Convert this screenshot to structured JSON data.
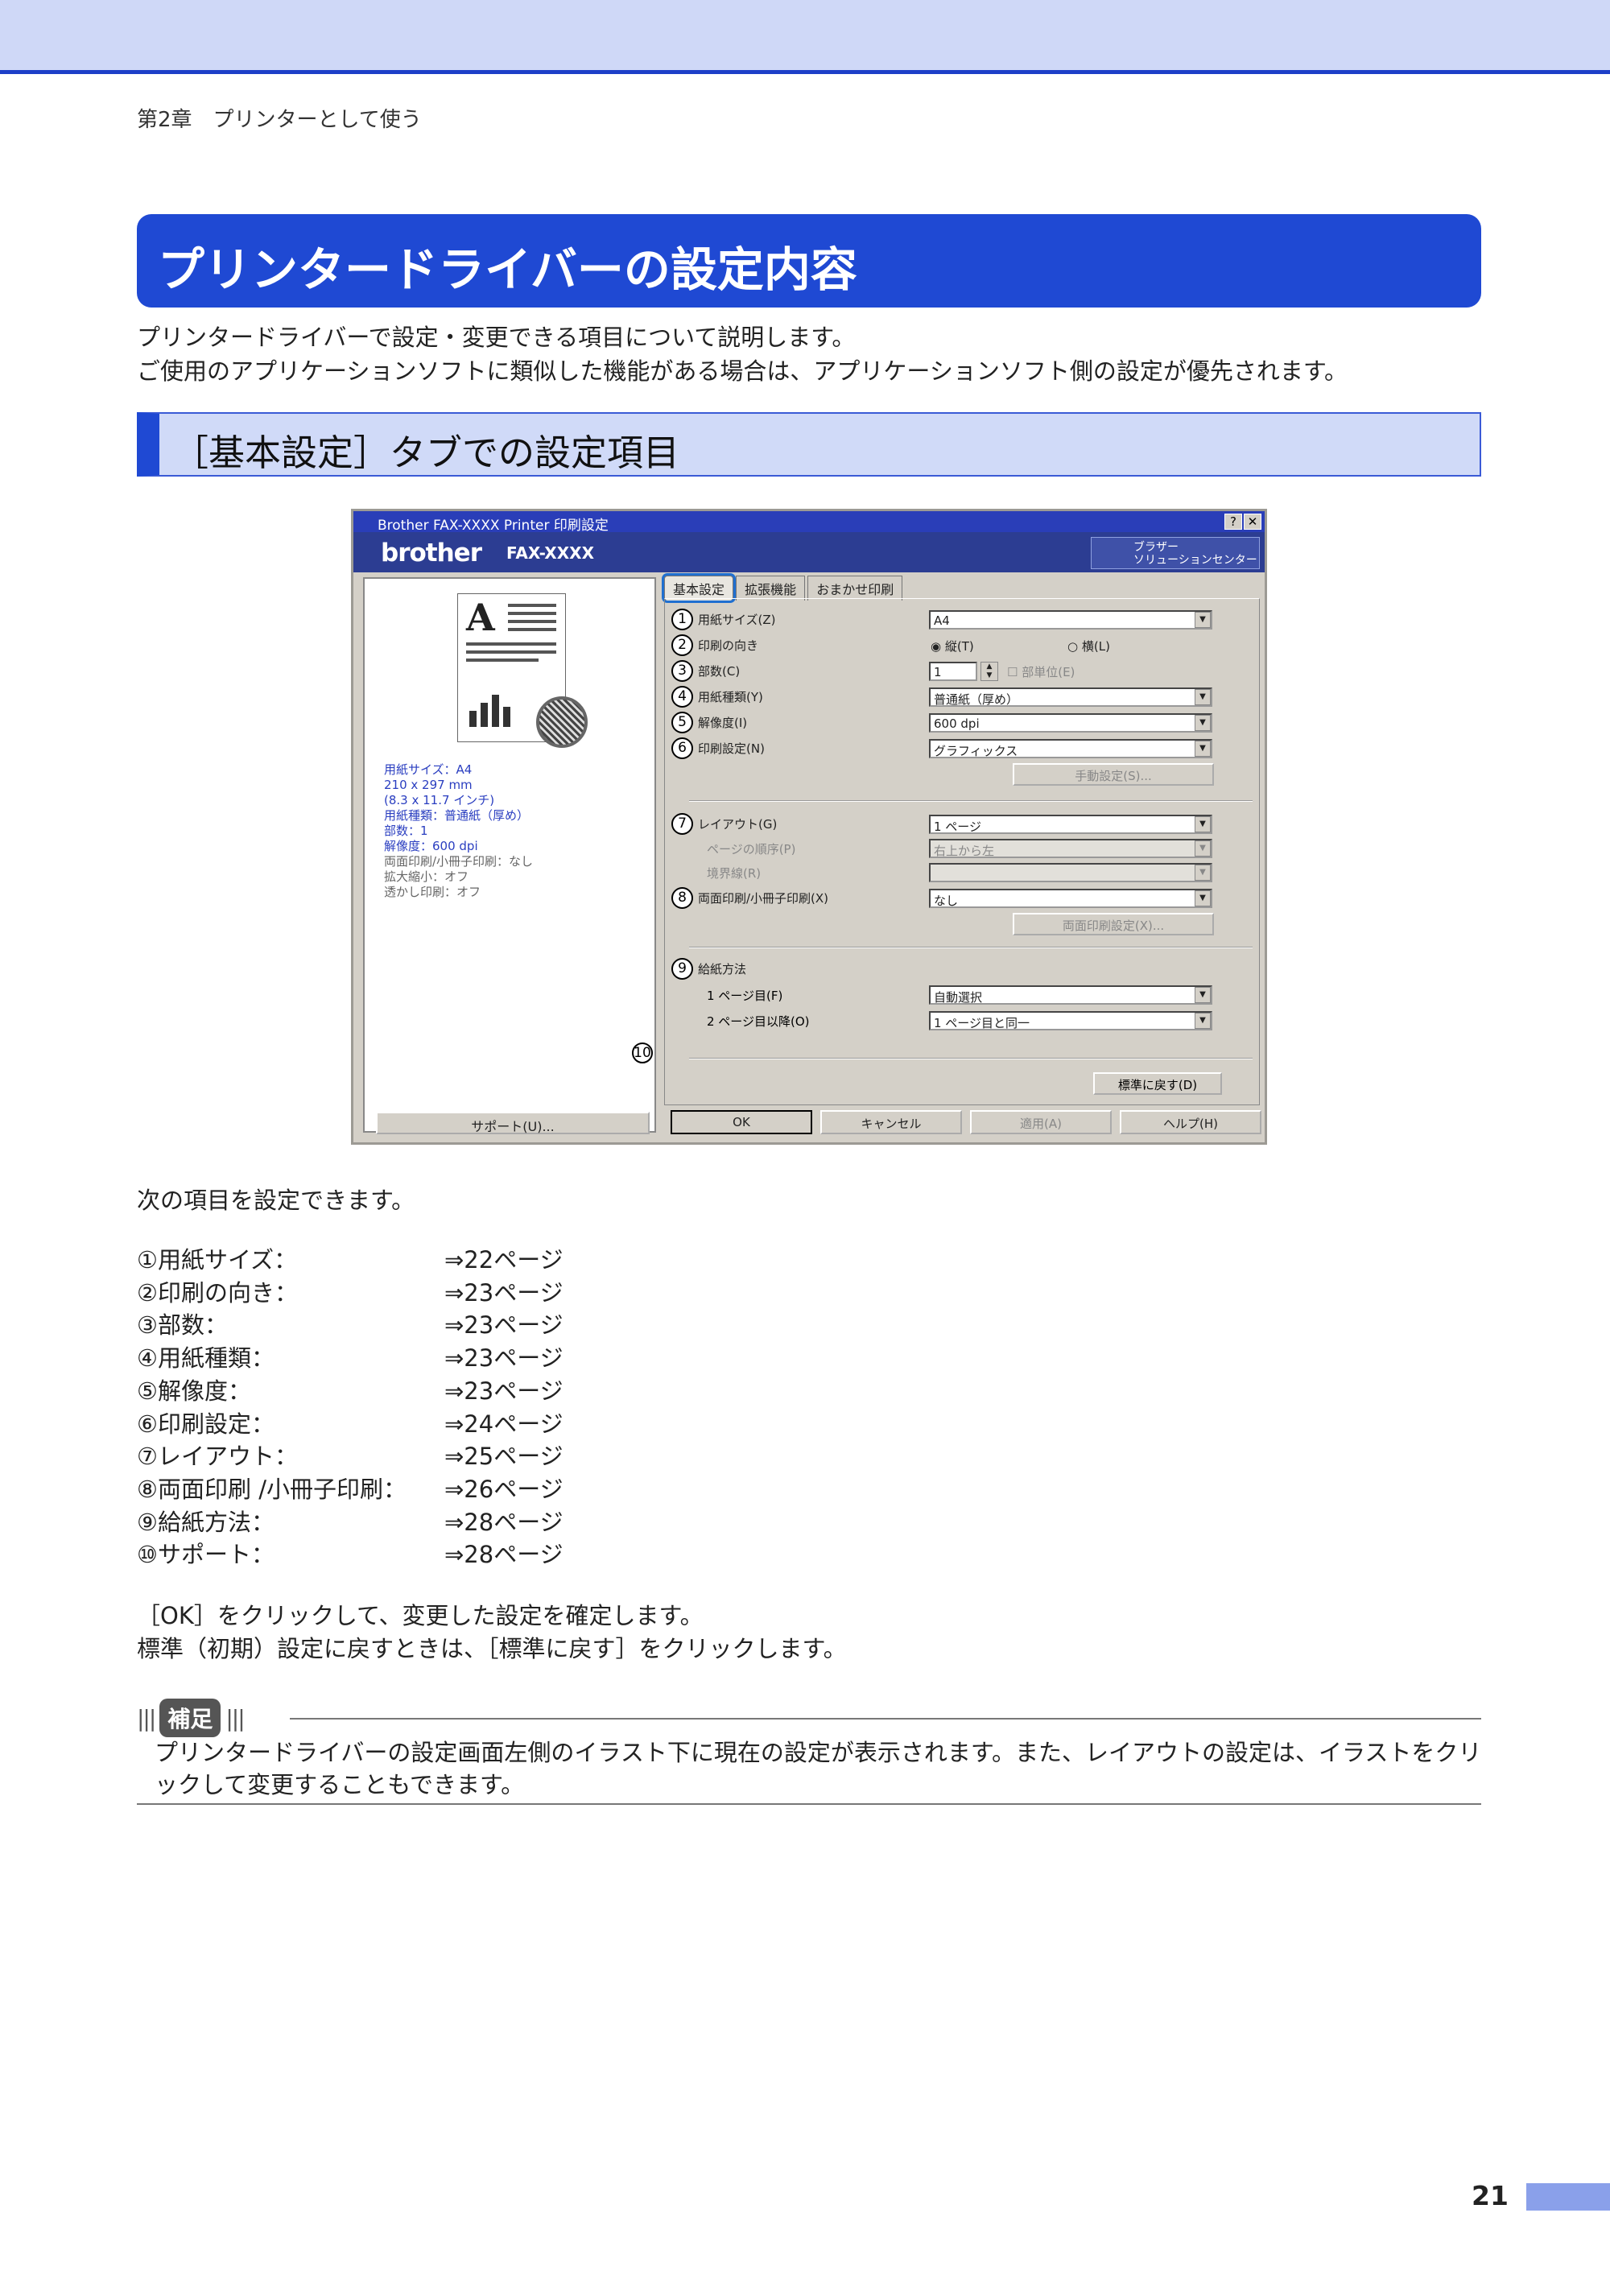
{
  "header": {
    "chapter": "第2章　プリンターとして使う"
  },
  "title": "プリンタードライバーの設定内容",
  "intro": [
    "プリンタードライバーで設定・変更できる項目について説明します。",
    "ご使用のアプリケーションソフトに類似した機能がある場合は、アプリケーションソフト側の設定が優先されます。"
  ],
  "section": "［基本設定］タブでの設定項目",
  "dialog": {
    "title": "Brother FAX-XXXX Printer 印刷設定",
    "help_btn": "?",
    "close_btn": "✕",
    "brand": "brother",
    "model": "FAX-XXXX",
    "solutions": [
      "ブラザー",
      "ソリューションセンター"
    ],
    "tabs": [
      "基本設定",
      "拡張機能",
      "おまかせ印刷"
    ],
    "summary": [
      "用紙サイズ：A4",
      "210 x 297 mm",
      "(8.3 x 11.7 インチ)",
      "用紙種類：普通紙（厚め）",
      "部数：1",
      "解像度：600 dpi",
      "両面印刷/小冊子印刷：なし",
      "拡大縮小：オフ",
      "透かし印刷：オフ"
    ],
    "support": "サポート(U)...",
    "rows": {
      "r1": {
        "num": "1",
        "label": "用紙サイズ(Z)",
        "value": "A4"
      },
      "r2": {
        "num": "2",
        "label": "印刷の向き",
        "opt1": "縦(T)",
        "opt2": "横(L)"
      },
      "r3": {
        "num": "3",
        "label": "部数(C)",
        "value": "1",
        "collate": "部単位(E)"
      },
      "r4": {
        "num": "4",
        "label": "用紙種類(Y)",
        "value": "普通紙（厚め）"
      },
      "r5": {
        "num": "5",
        "label": "解像度(I)",
        "value": "600 dpi"
      },
      "r6": {
        "num": "6",
        "label": "印刷設定(N)",
        "value": "グラフィックス",
        "btn": "手動設定(S)..."
      },
      "r7": {
        "num": "7",
        "label": "レイアウト(G)",
        "value": "1 ページ",
        "sub1": "ページの順序(P)",
        "sub1_value": "右上から左",
        "sub2": "境界線(R)"
      },
      "r8": {
        "num": "8",
        "label": "両面印刷/小冊子印刷(X)",
        "value": "なし",
        "btn": "両面印刷設定(X)..."
      },
      "r9": {
        "num": "9",
        "label": "給紙方法",
        "sub1": "1 ページ目(F)",
        "sub1_value": "自動選択",
        "sub2": "2 ページ目以降(O)",
        "sub2_value": "1 ページ目と同一"
      }
    },
    "default_btn": "標準に戻す(D)",
    "num10": "10",
    "buttons": {
      "ok": "OK",
      "cancel": "キャンセル",
      "apply": "適用(A)",
      "help": "ヘルプ(H)"
    }
  },
  "after_text": "次の項目を設定できます。",
  "items": [
    {
      "label": "①用紙サイズ：",
      "ref": "⇒22ページ"
    },
    {
      "label": "②印刷の向き：",
      "ref": "⇒23ページ"
    },
    {
      "label": "③部数：",
      "ref": "⇒23ページ"
    },
    {
      "label": "④用紙種類：",
      "ref": "⇒23ページ"
    },
    {
      "label": "⑤解像度：",
      "ref": "⇒23ページ"
    },
    {
      "label": "⑥印刷設定：",
      "ref": "⇒24ページ"
    },
    {
      "label": "⑦レイアウト：",
      "ref": "⇒25ページ"
    },
    {
      "label": "⑧両面印刷 /小冊子印刷：",
      "ref": "⇒26ページ"
    },
    {
      "label": "⑨給紙方法：",
      "ref": "⇒28ページ"
    },
    {
      "label": "⑩サポート：",
      "ref": "⇒28ページ"
    }
  ],
  "para": [
    "［OK］をクリックして、変更した設定を確定します。",
    "標準（初期）設定に戻すときは、［標準に戻す］をクリックします。"
  ],
  "note": {
    "badge": "補足",
    "text": "プリンタードライバーの設定画面左側のイラスト下に現在の設定が表示されます。また、レイアウトの設定は、イラストをクリックして変更することもできます。"
  },
  "page_number": "21"
}
